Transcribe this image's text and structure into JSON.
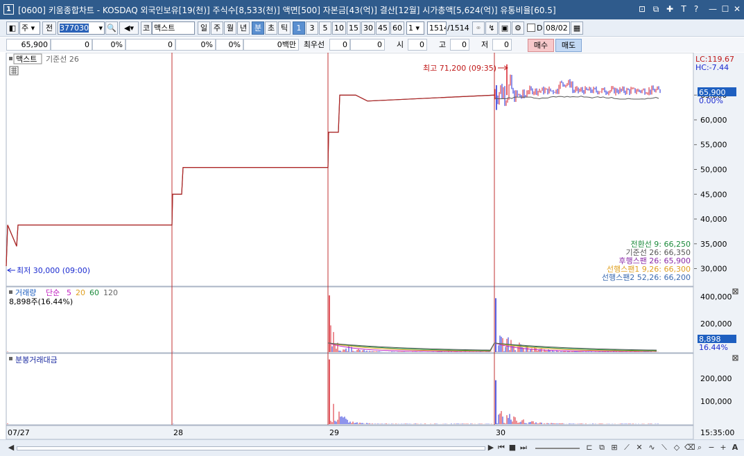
{
  "window": {
    "number": "1",
    "title": "[0600] 키움종합차트 - KOSDAQ 외국인보유[19(천)] 주식수[8,533(천)] 액면[500] 자본금[43(억)] 결산[12월] 시가총액[5,624(억)] 유통비율[60.5]"
  },
  "toolbar": {
    "type_select": "주",
    "mode_button": "전",
    "code_value": "377030",
    "code_prefix": "코",
    "stock_name": "맥스트",
    "period_buttons": [
      "일",
      "주",
      "월",
      "년",
      "분",
      "초",
      "틱"
    ],
    "active_period": "분",
    "minute_buttons": [
      "1",
      "3",
      "5",
      "10",
      "15",
      "30",
      "45",
      "60"
    ],
    "active_minute": "1",
    "multiplier": "1",
    "count_current": "1514",
    "count_total": "/1514",
    "d_label": "D",
    "date_value": "08/02"
  },
  "info": {
    "price": "65,900",
    "change": "0",
    "change_pct": "0%",
    "volume": "0",
    "volume_pct": "0%",
    "pct3": "0%",
    "amount": "0백만",
    "best_label": "최우선",
    "bid1": "0",
    "bid2": "0",
    "open_label": "시",
    "open_value": "0",
    "high_label": "고",
    "high_value": "0",
    "low_label": "저",
    "low_value": "0",
    "buy_label": "매수",
    "sell_label": "매도"
  },
  "price_panel": {
    "legend_name": "맥스트",
    "legend_line": "기준선 26",
    "high_annotation": "최고 71,200 (09:35)",
    "low_annotation": "최저 30,000 (09:00)",
    "lc_label": "LC:119.67",
    "hc_label": "HC:-7.44",
    "current_price": "65,900",
    "current_pct": "0.00%",
    "y_ticks": [
      "65,000",
      "60,000",
      "55,000",
      "50,000",
      "45,000",
      "40,000",
      "35,000",
      "30,000"
    ],
    "ichimoku_legend": [
      {
        "text": "전환선 9: 66,250",
        "color": "#1a8a3a"
      },
      {
        "text": "기준선 26: 66,350",
        "color": "#555555"
      },
      {
        "text": "후행스팬 26: 65,900",
        "color": "#8a2aa8"
      },
      {
        "text": "선행스팬1 9,26: 66,300",
        "color": "#e0a020"
      },
      {
        "text": "선행스팬2 52,26: 66,200",
        "color": "#3a6ab0"
      }
    ]
  },
  "volume_panel": {
    "legend_title": "거래량",
    "legend_ma_label": "단순",
    "legend_ma": [
      {
        "text": "5",
        "color": "#c020c0"
      },
      {
        "text": "20",
        "color": "#e0a020"
      },
      {
        "text": "60",
        "color": "#1a8a3a"
      },
      {
        "text": "120",
        "color": "#666666"
      }
    ],
    "volume_value": "8,898주(16.44%)",
    "current_value": "8,898",
    "current_pct": "16.44%",
    "y_ticks": [
      "400,000",
      "200,000"
    ]
  },
  "amount_panel": {
    "legend_title": "분봉거래대금",
    "y_ticks": [
      "200,000",
      "100,000"
    ]
  },
  "x_axis": {
    "labels": [
      "07/27",
      "28",
      "29",
      "30"
    ],
    "last_time": "15:35:00"
  },
  "chart_data": [
    {
      "type": "line",
      "title": "",
      "categories": [
        "07/27",
        "28",
        "29",
        "30"
      ],
      "series": [
        {
          "values": [
            38800,
            50400,
            65000,
            65900
          ]
        }
      ],
      "ylim": [
        27000,
        73000
      ],
      "annotations": [
        "최고 71,200 (09:35)",
        "최저 30,000 (09:00)"
      ]
    },
    {
      "type": "bar",
      "title": "",
      "categories": [
        "07/27",
        "28",
        "29",
        "30"
      ],
      "values": [
        2000,
        1000,
        400000,
        380000
      ],
      "ylim": [
        0,
        450000
      ]
    },
    {
      "type": "bar",
      "title": "",
      "categories": [
        "07/27",
        "28",
        "29",
        "30"
      ],
      "values": [
        2000,
        1000,
        280000,
        190000
      ],
      "ylim": [
        0,
        300000
      ]
    }
  ],
  "colors": {
    "title_bar": "#2f5b8c",
    "price_line": "#b22222",
    "base_line": "#555555",
    "up": "#d81e28",
    "down": "#1e2ad8",
    "axis_highlight": "#1e5fc0"
  }
}
